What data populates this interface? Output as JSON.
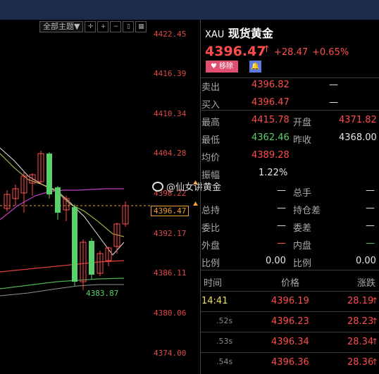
{
  "toolbar": {
    "theme_label": "全部主题▼"
  },
  "y_ticks": [
    "4422.45",
    "4416.39",
    "4410.34",
    "4404.28",
    "4398.22",
    "4392.17",
    "4386.11",
    "4380.06",
    "4374.00"
  ],
  "current_price_tag": "4396.47",
  "low_label": "4383.87",
  "watermark": "@仙女讲黄金",
  "colors": {
    "up": "#ff4d4d",
    "down": "#5ad06a",
    "bg": "#000000",
    "header": "#1e2a4a"
  },
  "quote": {
    "symbol": "XAU",
    "name": "现货黄金",
    "price": "4396.47",
    "change": "+28.47",
    "change_pct": "+0.65%",
    "remove_label": "移除",
    "heart_icon": "heart-icon",
    "bell_icon": "bell-icon"
  },
  "depth": [
    {
      "label": "卖出",
      "value": "4396.82",
      "extra": "—"
    },
    {
      "label": "买入",
      "value": "4396.47",
      "extra": "—"
    }
  ],
  "stats": [
    {
      "l1": "最高",
      "v1": "4415.78",
      "l2": "开盘",
      "v2": "4371.82"
    },
    {
      "l1": "最低",
      "v1": "4362.46",
      "l2": "昨收",
      "v2": "4368.00"
    },
    {
      "l1": "均价",
      "v1": "4389.28",
      "l2": "",
      "v2": ""
    },
    {
      "l1": "振幅",
      "v1": "1.22%",
      "l2": "",
      "v2": ""
    },
    {
      "l1": "",
      "v1": "—",
      "l2": "总手",
      "v2": "—"
    },
    {
      "l1": "总持",
      "v1": "—",
      "l2": "持仓差",
      "v2": "—"
    },
    {
      "l1": "委比",
      "v1": "—",
      "l2": "委差",
      "v2": "—"
    },
    {
      "l1": "外盘",
      "v1": "—",
      "l2": "内盘",
      "v2": "—"
    },
    {
      "l1": "比例",
      "v1": "0.00",
      "l2": "比例",
      "v2": "0.00"
    }
  ],
  "ticks_header": {
    "time": "时间",
    "price": "价格",
    "change": "涨跌"
  },
  "ticks": [
    {
      "time": "14:41",
      "price": "4396.19",
      "change": "28.19"
    },
    {
      "time": ".52s",
      "price": "4396.23",
      "change": "28.23"
    },
    {
      "time": ".53s",
      "price": "4396.34",
      "change": "28.34"
    },
    {
      "time": ".54s",
      "price": "4396.36",
      "change": "28.36"
    }
  ]
}
